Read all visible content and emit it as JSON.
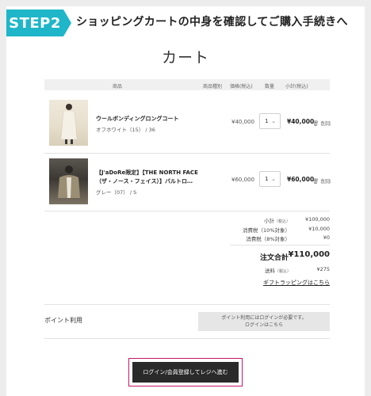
{
  "step": {
    "tag": "STEP2",
    "title": "ショッピングカートの中身を確認してご購入手続きへ"
  },
  "page_title": "カート",
  "table_header": {
    "product": "商品",
    "variant": "商品種別",
    "price": "価格(税込)",
    "qty": "数量",
    "subtotal": "小計(税込)"
  },
  "items": [
    {
      "name": "ウールボンディングロングコート",
      "name_line2": "",
      "variant": "オフホワイト（15） / 36",
      "price": "¥40,000",
      "qty": "1",
      "subtotal": "¥40,000",
      "delete": "削除"
    },
    {
      "name": "【J'aDoRe限定】【THE NORTH FACE",
      "name_line2": "（ザ・ノース・フェイス）】バルトロ…",
      "variant": "グレー（07） / S",
      "price": "¥60,000",
      "qty": "1",
      "subtotal": "¥60,000",
      "delete": "削除"
    }
  ],
  "totals": {
    "subtotal_label": "小計",
    "subtotal_tax": "（税込）",
    "subtotal_value": "¥100,000",
    "tax10_label": "消費税（10%対象）",
    "tax10_value": "¥10,000",
    "tax8_label": "消費税（8%対象）",
    "tax8_value": "¥0",
    "grand_label": "注文合計",
    "grand_value": "¥110,000",
    "shipping_label": "送料",
    "shipping_tax": "（税込）",
    "shipping_value": "¥275",
    "gift_link": "ギフトラッピングはこちら"
  },
  "points": {
    "label": "ポイント利用",
    "notice_line1": "ポイント利用にはログインが必要です。",
    "notice_line2": "ログインはこちら"
  },
  "login_button": "ログイン/会員登録してレジへ進む",
  "colors": {
    "step_accent": "#1fb6c9",
    "highlight_frame": "#c2186b",
    "button_bg": "#2a2a2a"
  }
}
